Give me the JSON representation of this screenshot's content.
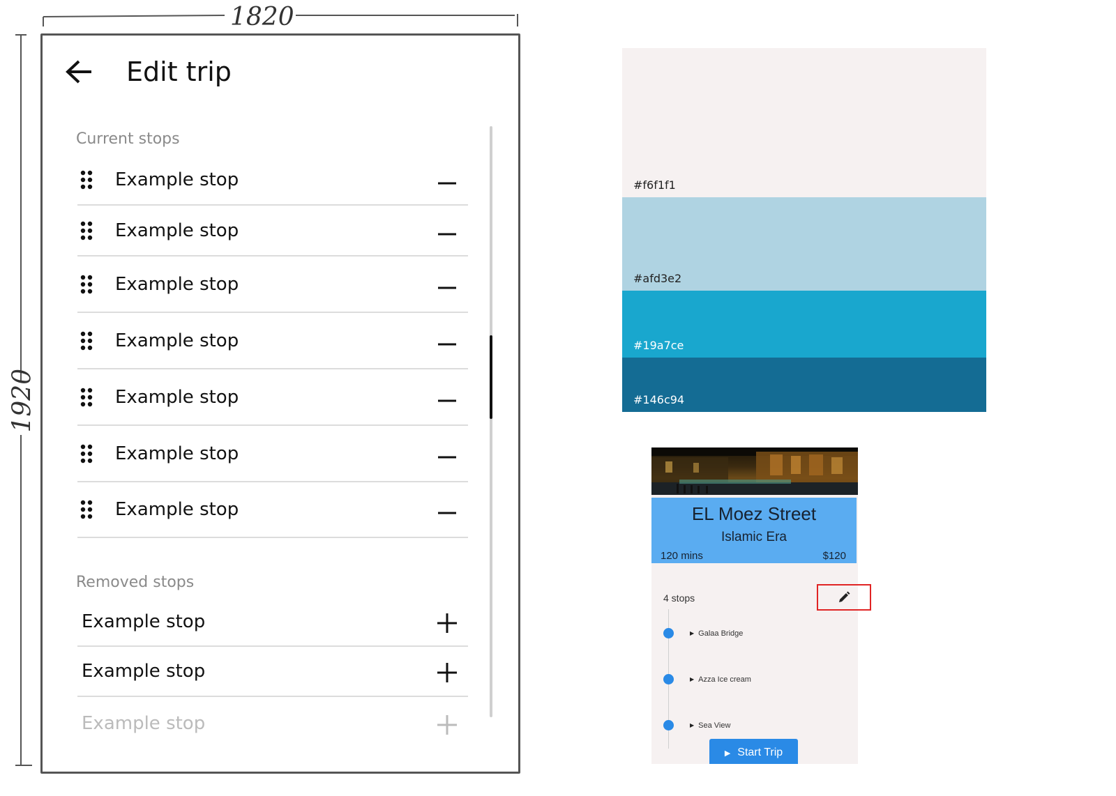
{
  "annotations": {
    "width_label": "1820",
    "height_label": "1920"
  },
  "wireframe": {
    "title": "Edit trip",
    "current_section_label": "Current stops",
    "current_stops": [
      "Example stop",
      "Example stop",
      "Example stop",
      "Example stop",
      "Example stop",
      "Example stop",
      "Example stop"
    ],
    "removed_section_label": "Removed stops",
    "removed_stops": [
      "Example stop",
      "Example stop",
      "Example stop"
    ],
    "icons": {
      "back": "arrow-left-icon",
      "drag": "drag-handle-icon",
      "remove": "minus-icon",
      "add": "plus-icon"
    }
  },
  "palette": [
    {
      "hex": "#f6f1f1",
      "label": "#f6f1f1"
    },
    {
      "hex": "#afd3e2",
      "label": "#afd3e2"
    },
    {
      "hex": "#19a7ce",
      "label": "#19a7ce"
    },
    {
      "hex": "#146c94",
      "label": "#146c94"
    }
  ],
  "trip_card": {
    "title": "EL Moez Street",
    "era": "Islamic Era",
    "duration": "120 mins",
    "price": "$120",
    "stops_count": "4 stops",
    "stops": [
      "Galaa Bridge",
      "Azza Ice cream",
      "Sea View"
    ],
    "start_button": "Start Trip",
    "colors": {
      "info_box": "#5aacf1",
      "accent": "#2a8ae6",
      "highlight": "#e02424"
    },
    "icons": {
      "edit": "pencil-icon",
      "play": "play-icon",
      "caret": "caret-right-icon"
    }
  }
}
